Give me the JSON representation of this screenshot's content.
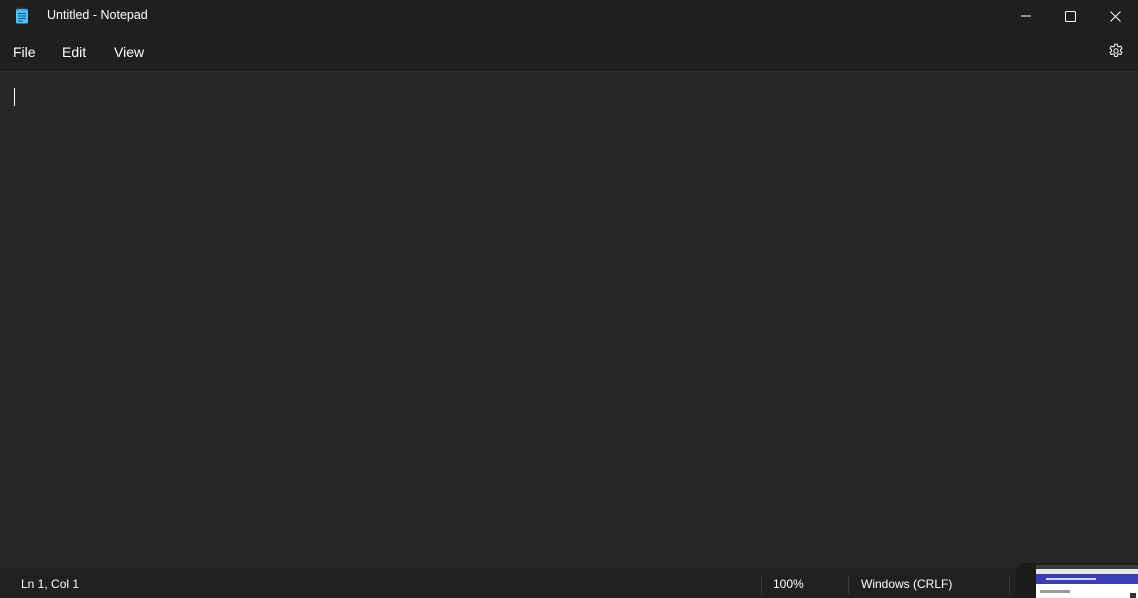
{
  "window": {
    "title": "Untitled - Notepad",
    "icon": "notepad-icon",
    "controls": {
      "minimize": "minimize-icon",
      "maximize": "maximize-icon",
      "close": "close-icon"
    }
  },
  "menu": {
    "file": "File",
    "edit": "Edit",
    "view": "View",
    "settings_icon": "gear-icon"
  },
  "editor": {
    "content": ""
  },
  "status": {
    "position": "Ln 1, Col 1",
    "zoom": "100%",
    "line_ending": "Windows (CRLF)"
  },
  "colors": {
    "titlebar_bg": "#1f1f1f",
    "editor_bg": "#272727",
    "statusbar_bg": "#202020",
    "text": "#ffffff",
    "icon_accent": "#4cc2ff"
  }
}
